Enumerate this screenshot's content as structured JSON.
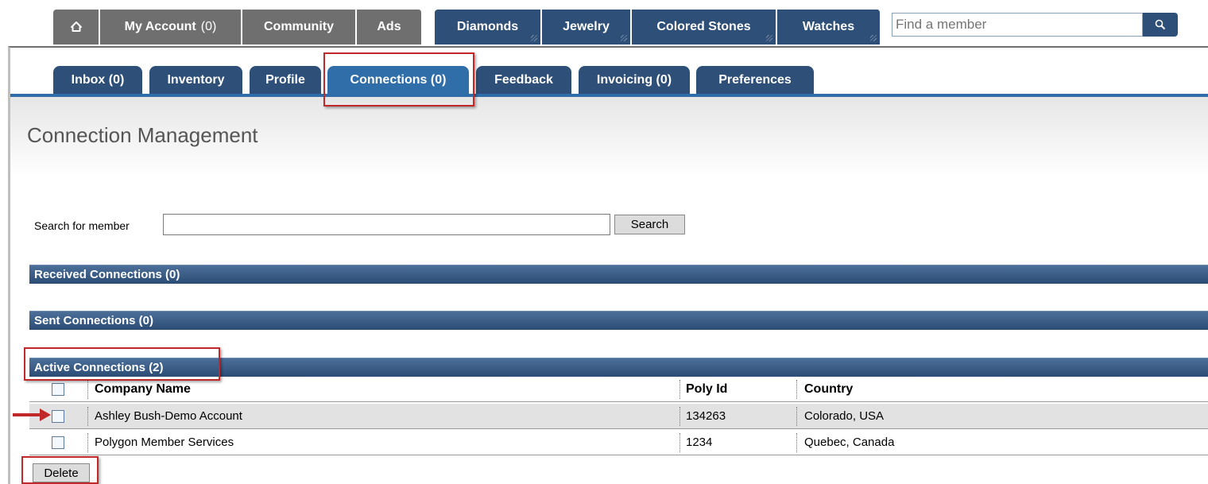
{
  "topnav": {
    "my_account_label": "My Account",
    "my_account_count": "(0)",
    "community_label": "Community",
    "ads_label": "Ads",
    "diamonds_label": "Diamonds",
    "jewelry_label": "Jewelry",
    "colored_stones_label": "Colored Stones",
    "watches_label": "Watches",
    "find_member_placeholder": "Find a member",
    "icons": [
      "home-icon",
      "search-icon"
    ]
  },
  "subnav": {
    "tabs": [
      {
        "label": "Inbox (0)"
      },
      {
        "label": "Inventory"
      },
      {
        "label": "Profile"
      },
      {
        "label": "Connections (0)",
        "active": true
      },
      {
        "label": "Feedback"
      },
      {
        "label": "Invoicing (0)"
      },
      {
        "label": "Preferences"
      }
    ]
  },
  "page": {
    "title": "Connection Management",
    "search_label": "Search for member",
    "search_value": "",
    "search_button": "Search"
  },
  "sections": {
    "received": "Received Connections (0)",
    "sent": "Sent Connections (0)",
    "active": "Active Connections (2)"
  },
  "table": {
    "headers": {
      "company": "Company Name",
      "poly_id": "Poly Id",
      "country": "Country"
    },
    "rows": [
      {
        "company": "Ashley Bush-Demo Account",
        "poly_id": "134263",
        "country": "Colorado,  USA"
      },
      {
        "company": "Polygon Member Services",
        "poly_id": "1234",
        "country": "Quebec,  Canada"
      }
    ]
  },
  "actions": {
    "delete_button": "Delete"
  },
  "colors": {
    "nav_gray": "#6f6f6f",
    "nav_blue": "#2d4f78",
    "active_tab": "#2f6ea8",
    "annotation_red": "#c0282a"
  }
}
